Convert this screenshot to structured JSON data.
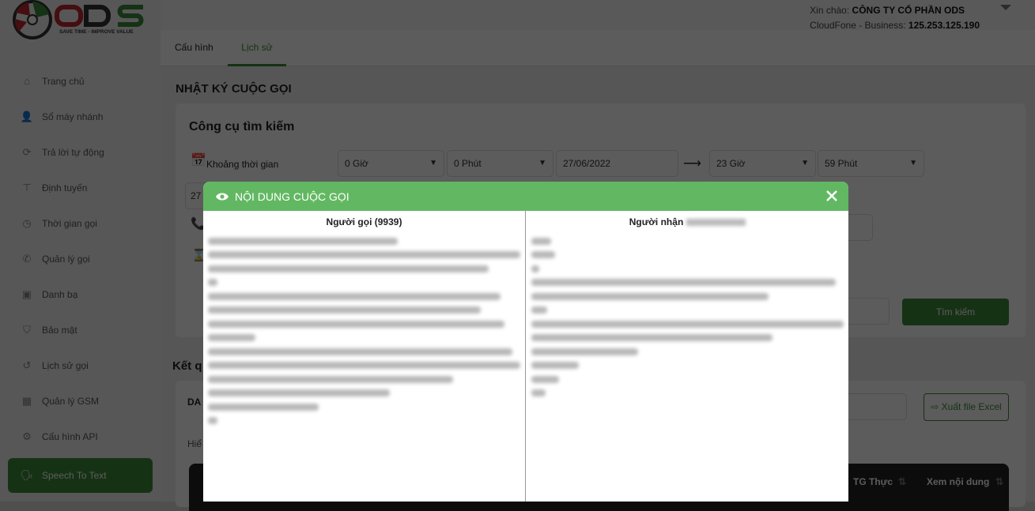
{
  "brand": {
    "name": "ODS",
    "tagline": "SAVE TIME - IMPROVE VALUE",
    "colors": {
      "red": "#c0272d",
      "dark": "#333333",
      "green": "#3c8a3b"
    }
  },
  "header": {
    "greeting_label": "Xin chào:",
    "company": "CÔNG TY CỔ PHẦN ODS",
    "plan_label": "CloudFone - Business:",
    "ip": "125.253.125.190"
  },
  "sidebar": {
    "items": [
      {
        "label": "Trang chủ",
        "icon": "home-icon"
      },
      {
        "label": "Sổ máy nhánh",
        "icon": "user-gear-icon"
      },
      {
        "label": "Trả lời tự động",
        "icon": "refresh-icon"
      },
      {
        "label": "Định tuyến",
        "icon": "signpost-icon"
      },
      {
        "label": "Thời gian gọi",
        "icon": "clock-icon"
      },
      {
        "label": "Quản lý gọi",
        "icon": "phone-icon"
      },
      {
        "label": "Danh bạ",
        "icon": "contacts-icon"
      },
      {
        "label": "Bảo mật",
        "icon": "shield-icon"
      },
      {
        "label": "Lịch sử gọi",
        "icon": "history-icon"
      },
      {
        "label": "Quản lý GSM",
        "icon": "sim-icon"
      },
      {
        "label": "Cấu hình API",
        "icon": "gear-icon"
      },
      {
        "label": "Speech To Text",
        "icon": "speaking-user-icon",
        "active": true
      }
    ]
  },
  "tabs": [
    {
      "label": "Cấu hình"
    },
    {
      "label": "Lịch sử",
      "active": true
    }
  ],
  "page": {
    "title": "NHẬT KÝ CUỘC GỌI",
    "search": {
      "title": "Công cụ tìm kiếm",
      "time_range_label": "Khoảng thời gian",
      "from_hour": "0 Giờ",
      "from_minute": "0 Phút",
      "to_date": "27/06/2022",
      "to_hour": "23 Giờ",
      "to_minute": "59 Phút",
      "from_date_partial": "27",
      "search_button": "Tìm kiếm"
    },
    "results": {
      "title_partial": "Kết q",
      "list_partial": "DA",
      "show_partial": "Hiể",
      "export_button": "Xuất file Excel",
      "columns": [
        "TG Thực",
        "Xem nội dung"
      ]
    }
  },
  "modal": {
    "title": "NỘI DUNG CUỘC GỌI",
    "caller_label": "Người gọi (9939)",
    "receiver_label": "Người nhận",
    "accent": "#62b862"
  }
}
